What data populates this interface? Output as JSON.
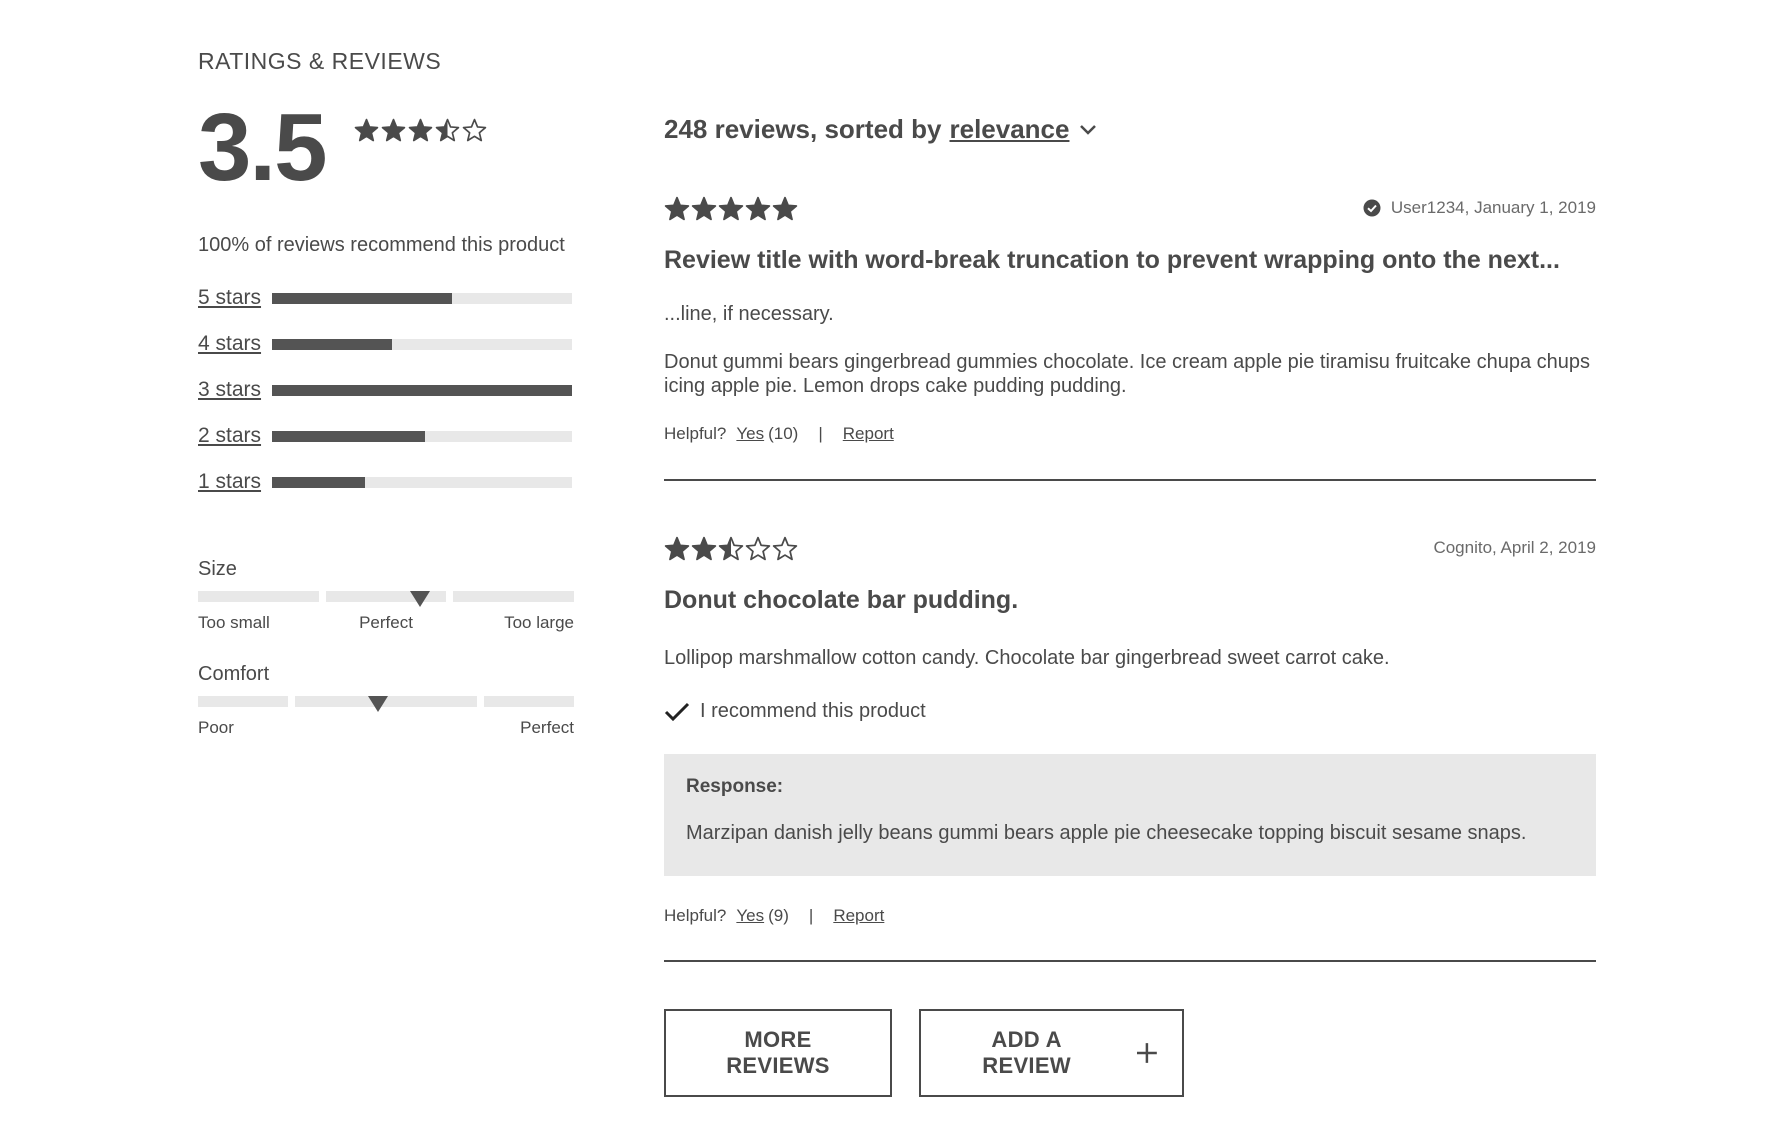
{
  "section_title": "RATINGS & REVIEWS",
  "summary": {
    "average": "3.5",
    "stars": 3.5,
    "recommend_text": "100% of reviews recommend this product"
  },
  "breakdown": [
    {
      "label": "5 stars",
      "fraction": 0.6
    },
    {
      "label": "4 stars",
      "fraction": 0.4
    },
    {
      "label": "3 stars",
      "fraction": 1.0
    },
    {
      "label": "2 stars",
      "fraction": 0.51
    },
    {
      "label": "1 stars",
      "fraction": 0.31
    }
  ],
  "characteristics": {
    "size": {
      "title": "Size",
      "low": "Too small",
      "mid": "Perfect",
      "high": "Too large",
      "level": 0.59
    },
    "comfort": {
      "title": "Comfort",
      "low": "Poor",
      "high": "Perfect",
      "level": 0.48
    }
  },
  "list_header": {
    "count_text": "248 reviews, sorted by",
    "sort_value": "relevance"
  },
  "reviews": [
    {
      "stars": 5,
      "verified": true,
      "meta": "User1234, January 1, 2019",
      "title": "Review title with word-break truncation to prevent wrapping onto the next...",
      "title_cont": "...line, if necessary.",
      "body": "Donut gummi bears gingerbread gummies chocolate. Ice cream apple pie tiramisu fruitcake chupa chups icing apple pie. Lemon drops cake pudding pudding.",
      "helpful_label": "Helpful?",
      "yes_label": "Yes",
      "yes_count": "(10)",
      "report_label": "Report"
    },
    {
      "stars": 2.5,
      "verified": false,
      "meta": "Cognito, April 2, 2019",
      "title": "Donut chocolate bar pudding.",
      "body": "Lollipop marshmallow cotton candy. Chocolate bar gingerbread sweet carrot cake.",
      "recommend_text": "I recommend this product",
      "response_label": "Response:",
      "response_text": "Marzipan danish jelly beans gummi bears apple pie cheesecake topping biscuit sesame snaps.",
      "helpful_label": "Helpful?",
      "yes_label": "Yes",
      "yes_count": "(9)",
      "report_label": "Report"
    }
  ],
  "buttons": {
    "more_reviews": "MORE REVIEWS",
    "add_review": "ADD A REVIEW"
  },
  "colors": {
    "text": "#4a4a4a",
    "bar_fill": "#545454",
    "bar_track": "#e8e8e8",
    "response_bg": "#e8e8e8"
  },
  "icons": [
    "star-icon",
    "half-star-icon",
    "empty-star-icon",
    "chevron-down-icon",
    "verified-check-icon",
    "checkmark-icon",
    "plus-icon"
  ]
}
